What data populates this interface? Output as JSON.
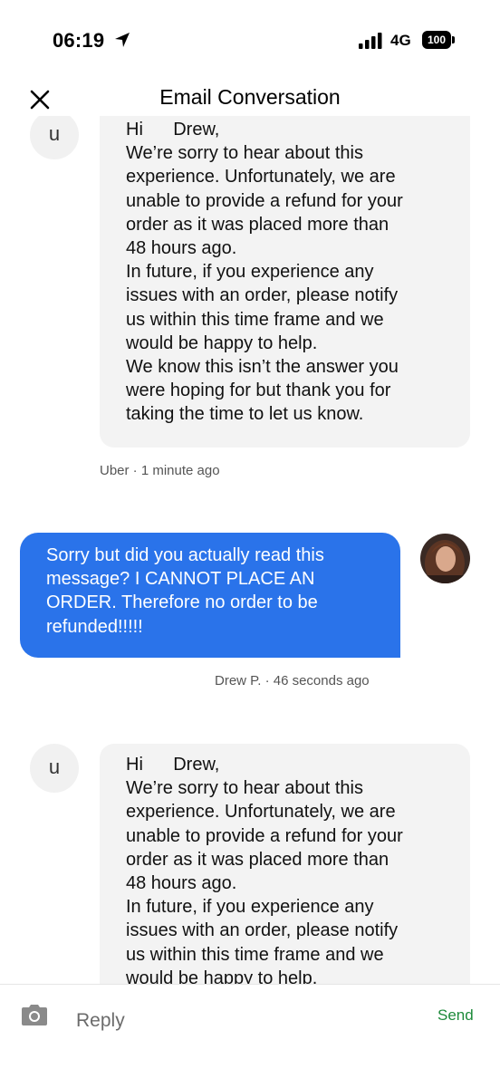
{
  "status_bar": {
    "time": "06:19",
    "network": "4G",
    "battery": "100"
  },
  "header": {
    "title": "Email Conversation",
    "close_icon": "close-icon"
  },
  "messages": [
    {
      "sender_initial": "u",
      "greeting": "Hi      Drew,",
      "lines": [
        "We’re sorry to hear about this",
        "experience. Unfortunately, we are",
        "unable to provide a refund for your",
        "order as it was placed more than",
        "48 hours ago.",
        "In future, if you experience any",
        "issues with an order, please notify",
        "us within this time frame and we",
        "would be happy to help.",
        "We know this isn’t the answer you",
        "were hoping for but thank you for",
        "taking the time to let us know."
      ],
      "meta": "Uber · 1 minute ago"
    },
    {
      "lines": [
        "Sorry but did you actually read this",
        "message? I CANNOT PLACE AN",
        "ORDER. Therefore no order to be",
        "refunded!!!!!"
      ],
      "meta": "Drew P. · 46 seconds ago"
    },
    {
      "sender_initial": "u",
      "greeting": "Hi      Drew,",
      "lines": [
        "We’re sorry to hear about this",
        "experience. Unfortunately, we are",
        "unable to provide a refund for your",
        "order as it was placed more than",
        "48 hours ago.",
        "In future, if you experience any",
        "issues with an order, please notify",
        "us within this time frame and we",
        "would be happy to help."
      ]
    }
  ],
  "footer": {
    "reply_placeholder": "Reply",
    "send_label": "Send",
    "camera_icon": "camera-icon"
  },
  "colors": {
    "outgoing_bubble": "#2a73ea",
    "incoming_bubble": "#f3f3f3",
    "send": "#1d8a3a"
  }
}
